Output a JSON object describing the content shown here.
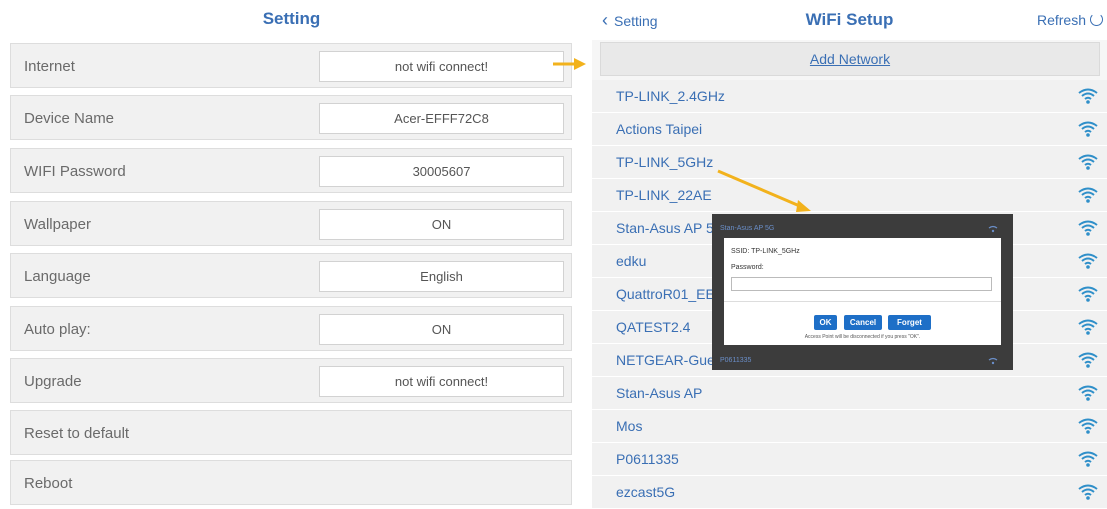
{
  "settings": {
    "title": "Setting",
    "rows": [
      {
        "label": "Internet",
        "value": "not wifi connect!"
      },
      {
        "label": "Device Name",
        "value": "Acer-EFFF72C8"
      },
      {
        "label": "WIFI Password",
        "value": "30005607"
      },
      {
        "label": "Wallpaper",
        "value": "ON"
      },
      {
        "label": "Language",
        "value": "English"
      },
      {
        "label": "Auto play:",
        "value": "ON"
      },
      {
        "label": "Upgrade",
        "value": "not wifi connect!"
      },
      {
        "label": "Reset to default",
        "value": null
      },
      {
        "label": "Reboot",
        "value": null
      }
    ]
  },
  "wifi": {
    "back_label": "Setting",
    "title": "WiFi Setup",
    "refresh_label": "Refresh",
    "add_network": "Add Network",
    "networks": [
      "TP-LINK_2.4GHz",
      "Actions Taipei",
      "TP-LINK_5GHz",
      "TP-LINK_22AE",
      "Stan-Asus AP 5",
      "edku",
      "QuattroR01_EE",
      "QATEST2.4",
      "NETGEAR-Gue",
      "Stan-Asus AP",
      "Mos",
      "P0611335",
      "ezcast5G"
    ],
    "signal_icon": "wifi-signal-icon"
  },
  "dialog": {
    "ssid": "SSID:  TP-LINK_5GHz",
    "password_label": "Password:",
    "password_value": "",
    "ok": "OK",
    "cancel": "Cancel",
    "forget": "Forget",
    "note": "Access Point will be disconnected if you press \"OK\".",
    "ghost_top": "Stan-Asus AP 5G",
    "ghost_bottom": "P0611335"
  },
  "colors": {
    "accent_blue": "#3a6fb4",
    "button_blue": "#1e6fc7",
    "annotation_arrow": "#f2b21c"
  }
}
